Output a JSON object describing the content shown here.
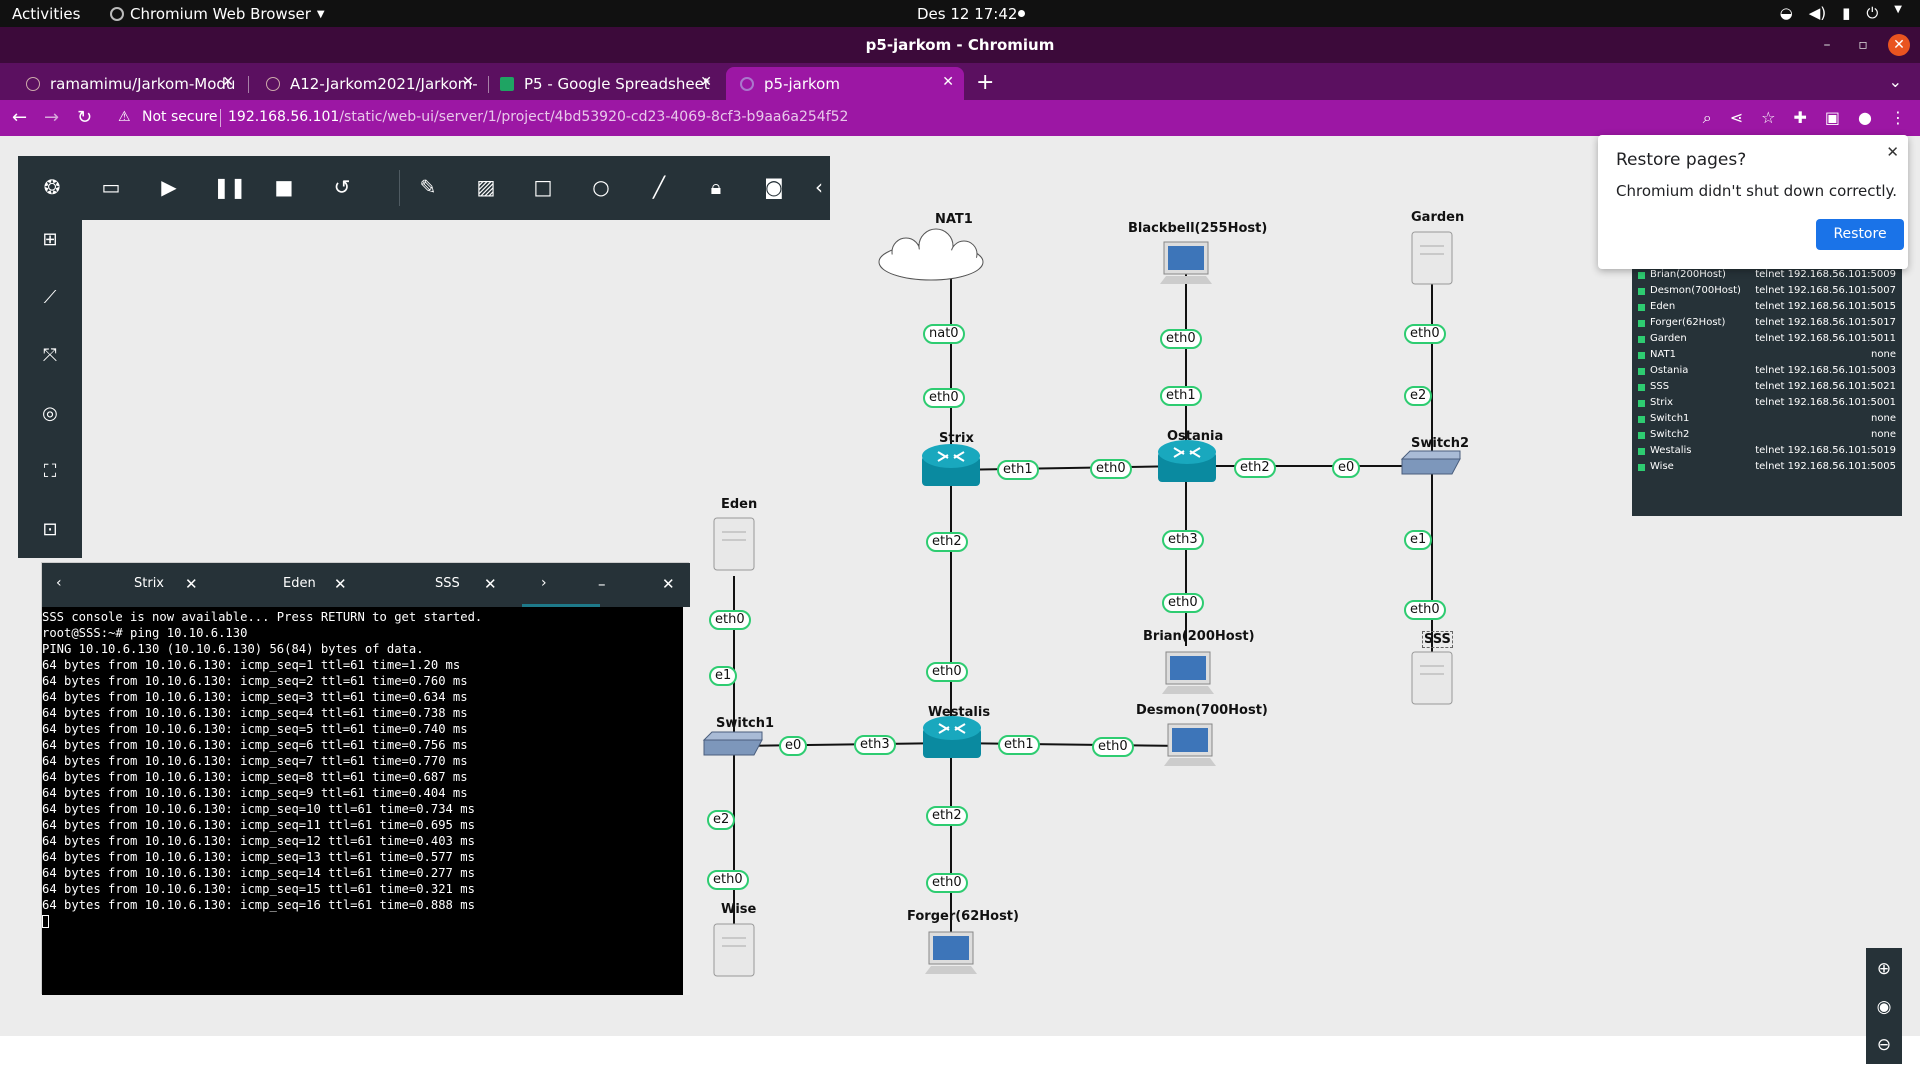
{
  "os": {
    "activities": "Activities",
    "app_name": "Chromium Web Browser",
    "clock": "Des 12  17:42"
  },
  "window": {
    "title": "p5-jarkom - Chromium"
  },
  "tabs": [
    {
      "label": "ramamimu/Jarkom-Modu"
    },
    {
      "label": "A12-Jarkom2021/Jarkom-"
    },
    {
      "label": "P5 - Google Spreadsheet"
    },
    {
      "label": "p5-jarkom"
    }
  ],
  "address": {
    "not_secure": "Not secure",
    "host": "192.168.56.101",
    "path": "/static/web-ui/server/1/project/4bd53920-cd23-4069-8cf3-b9aa6a254f52"
  },
  "restore_popup": {
    "title": "Restore pages?",
    "message": "Chromium didn't shut down correctly.",
    "button": "Restore"
  },
  "nodes": {
    "nat1": "NAT1",
    "blackbell": "Blackbell(255Host)",
    "garden": "Garden",
    "strix": "Strix",
    "ostania": "Ostania",
    "switch2": "Switch2",
    "eden": "Eden",
    "brian": "Brian(200Host)",
    "sss": "SSS",
    "switch1": "Switch1",
    "westalis": "Westalis",
    "desmon": "Desmon(700Host)",
    "wise": "Wise",
    "forger": "Forger(62Host)"
  },
  "ports": {
    "nat0": "nat0",
    "strix_eth0": "eth0",
    "bb_eth0": "eth0",
    "ost_eth1": "eth1",
    "garden_eth0": "eth0",
    "sw2_e2": "e2",
    "strix_eth1": "eth1",
    "ost_eth0": "eth0",
    "ost_eth2": "eth2",
    "sw2_e0": "e0",
    "strix_eth2": "eth2",
    "ost_eth3": "eth3",
    "sw2_e1": "e1",
    "brian_eth0": "eth0",
    "sss_eth0": "eth0",
    "eden_eth0": "eth0",
    "sw1_e1": "e1",
    "west_eth0": "eth0",
    "sw1_e0": "e0",
    "west_eth3": "eth3",
    "west_eth1": "eth1",
    "desmon_eth0": "eth0",
    "sw1_e2": "e2",
    "west_eth2": "eth2",
    "wise_eth0": "eth0",
    "forger_eth0": "eth0"
  },
  "node_list": [
    {
      "name": "Brian(200Host)",
      "console": "telnet 192.168.56.101:5009"
    },
    {
      "name": "Desmon(700Host)",
      "console": "telnet 192.168.56.101:5007"
    },
    {
      "name": "Eden",
      "console": "telnet 192.168.56.101:5015"
    },
    {
      "name": "Forger(62Host)",
      "console": "telnet 192.168.56.101:5017"
    },
    {
      "name": "Garden",
      "console": "telnet 192.168.56.101:5011"
    },
    {
      "name": "NAT1",
      "console": "none"
    },
    {
      "name": "Ostania",
      "console": "telnet 192.168.56.101:5003"
    },
    {
      "name": "SSS",
      "console": "telnet 192.168.56.101:5021"
    },
    {
      "name": "Strix",
      "console": "telnet 192.168.56.101:5001"
    },
    {
      "name": "Switch1",
      "console": "none"
    },
    {
      "name": "Switch2",
      "console": "none"
    },
    {
      "name": "Westalis",
      "console": "telnet 192.168.56.101:5019"
    },
    {
      "name": "Wise",
      "console": "telnet 192.168.56.101:5005"
    }
  ],
  "console": {
    "tabs": [
      "Strix",
      "Eden",
      "SSS"
    ],
    "lines": [
      "SSS console is now available... Press RETURN to get started.",
      "root@SSS:~# ping 10.10.6.130",
      "PING 10.10.6.130 (10.10.6.130) 56(84) bytes of data.",
      "64 bytes from 10.10.6.130: icmp_seq=1 ttl=61 time=1.20 ms",
      "64 bytes from 10.10.6.130: icmp_seq=2 ttl=61 time=0.760 ms",
      "64 bytes from 10.10.6.130: icmp_seq=3 ttl=61 time=0.634 ms",
      "64 bytes from 10.10.6.130: icmp_seq=4 ttl=61 time=0.738 ms",
      "64 bytes from 10.10.6.130: icmp_seq=5 ttl=61 time=0.740 ms",
      "64 bytes from 10.10.6.130: icmp_seq=6 ttl=61 time=0.756 ms",
      "64 bytes from 10.10.6.130: icmp_seq=7 ttl=61 time=0.770 ms",
      "64 bytes from 10.10.6.130: icmp_seq=8 ttl=61 time=0.687 ms",
      "64 bytes from 10.10.6.130: icmp_seq=9 ttl=61 time=0.404 ms",
      "64 bytes from 10.10.6.130: icmp_seq=10 ttl=61 time=0.734 ms",
      "64 bytes from 10.10.6.130: icmp_seq=11 ttl=61 time=0.695 ms",
      "64 bytes from 10.10.6.130: icmp_seq=12 ttl=61 time=0.403 ms",
      "64 bytes from 10.10.6.130: icmp_seq=13 ttl=61 time=0.577 ms",
      "64 bytes from 10.10.6.130: icmp_seq=14 ttl=61 time=0.277 ms",
      "64 bytes from 10.10.6.130: icmp_seq=15 ttl=61 time=0.321 ms",
      "64 bytes from 10.10.6.130: icmp_seq=16 ttl=61 time=0.888 ms"
    ]
  },
  "colors": {
    "toolbar_bg": "#263238",
    "link_port_border": "#2ecc71",
    "tab_active": "#9c17a4",
    "restore_button": "#1a73e8"
  }
}
